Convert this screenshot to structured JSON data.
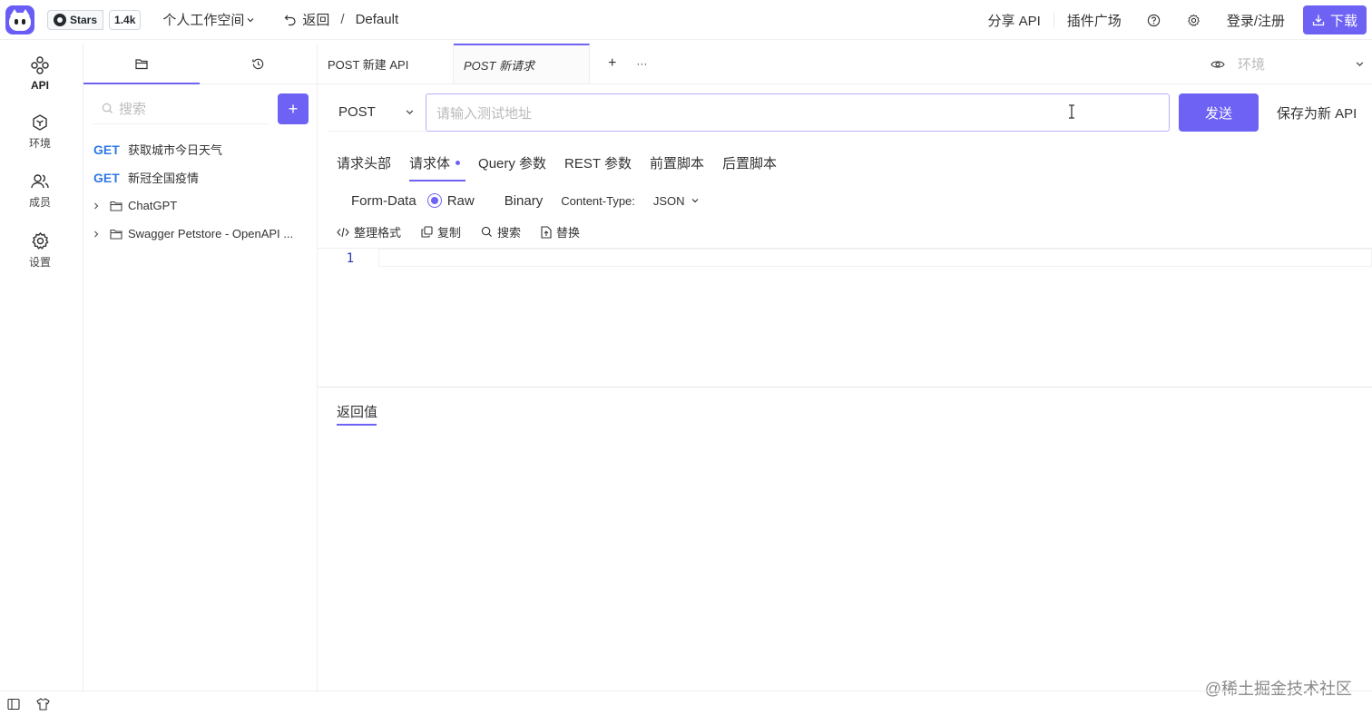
{
  "header": {
    "github_label": "Stars",
    "github_count": "1.4k",
    "workspace": "个人工作空间",
    "back_label": "返回",
    "separator": "/",
    "project": "Default",
    "share_api": "分享 API",
    "plugin_market": "插件广场",
    "login": "登录/注册",
    "download": "下载"
  },
  "rail": {
    "items": [
      {
        "label": "API",
        "icon": "api-icon"
      },
      {
        "label": "环境",
        "icon": "cube-icon"
      },
      {
        "label": "成员",
        "icon": "users-icon"
      },
      {
        "label": "设置",
        "icon": "gear-icon"
      }
    ]
  },
  "sidebar": {
    "search_placeholder": "搜索",
    "add": "+",
    "apis": [
      {
        "method": "GET",
        "name": "获取城市今日天气"
      },
      {
        "method": "GET",
        "name": "新冠全国疫情"
      }
    ],
    "folders": [
      {
        "name": "ChatGPT"
      },
      {
        "name": "Swagger Petstore - OpenAPI ..."
      }
    ]
  },
  "tabs": [
    {
      "label": "POST 新建 API"
    },
    {
      "label": "POST 新请求"
    }
  ],
  "tab_actions": {
    "add": "+",
    "more": "···"
  },
  "env": {
    "placeholder": "环境"
  },
  "request": {
    "method": "POST",
    "url_placeholder": "请输入测试地址",
    "send": "发送",
    "save_as": "保存为新 API"
  },
  "sub_tabs": [
    "请求头部",
    "请求体",
    "Query 参数",
    "REST 参数",
    "前置脚本",
    "后置脚本"
  ],
  "body": {
    "form_data": "Form-Data",
    "raw": "Raw",
    "binary": "Binary",
    "content_type_label": "Content-Type:",
    "content_type_value": "JSON"
  },
  "toolbar": {
    "format": "整理格式",
    "copy": "复制",
    "search": "搜索",
    "replace": "替换"
  },
  "editor": {
    "line_number": "1"
  },
  "response": {
    "tab": "返回值"
  },
  "watermark": "@稀土掘金技术社区",
  "colors": {
    "accent": "#6e62f5",
    "get_method": "#2f78e8"
  }
}
